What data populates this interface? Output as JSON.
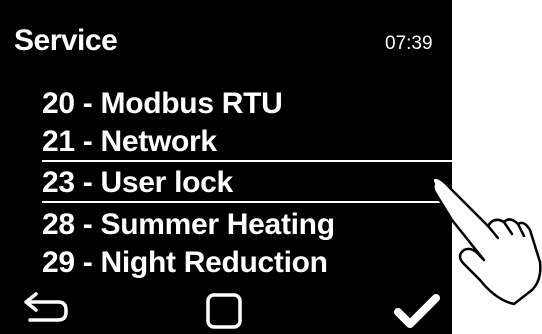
{
  "header": {
    "title": "Service",
    "time": "07:39"
  },
  "menu": {
    "items": [
      {
        "label": "20 - Modbus RTU"
      },
      {
        "label": "21 - Network"
      },
      {
        "label": "23 - User lock",
        "selected": true
      },
      {
        "label": "28 - Summer Heating"
      },
      {
        "label": "29 - Night Reduction"
      }
    ]
  },
  "footer": {
    "back_icon": "back-arrow-icon",
    "home_icon": "square-icon",
    "confirm_icon": "checkmark-icon"
  },
  "overlay": {
    "icon": "pointing-hand-icon"
  },
  "colors": {
    "screen_background": "#000000",
    "foreground": "#ffffff",
    "page_background": "#ffffff"
  }
}
